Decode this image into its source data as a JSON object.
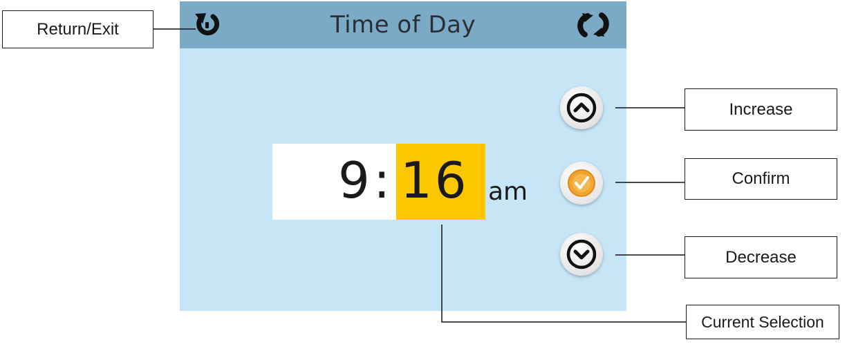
{
  "screen": {
    "title": "Time of Day",
    "header_color": "#7aaac6",
    "background_color": "#c6e5f6",
    "return_icon": "return-icon",
    "refresh_icon": "refresh-icon"
  },
  "time": {
    "hour": "9",
    "separator": ":",
    "minute": "16",
    "period": "am",
    "selected_field": "minute",
    "highlight_color": "#fdc700"
  },
  "controls": {
    "increase_icon": "chevron-up-icon",
    "confirm_icon": "check-icon",
    "decrease_icon": "chevron-down-icon",
    "confirm_color": "#f0a431"
  },
  "callouts": {
    "return_exit": "Return/Exit",
    "increase": "Increase",
    "confirm": "Confirm",
    "decrease": "Decrease",
    "current_selection": "Current Selection"
  }
}
